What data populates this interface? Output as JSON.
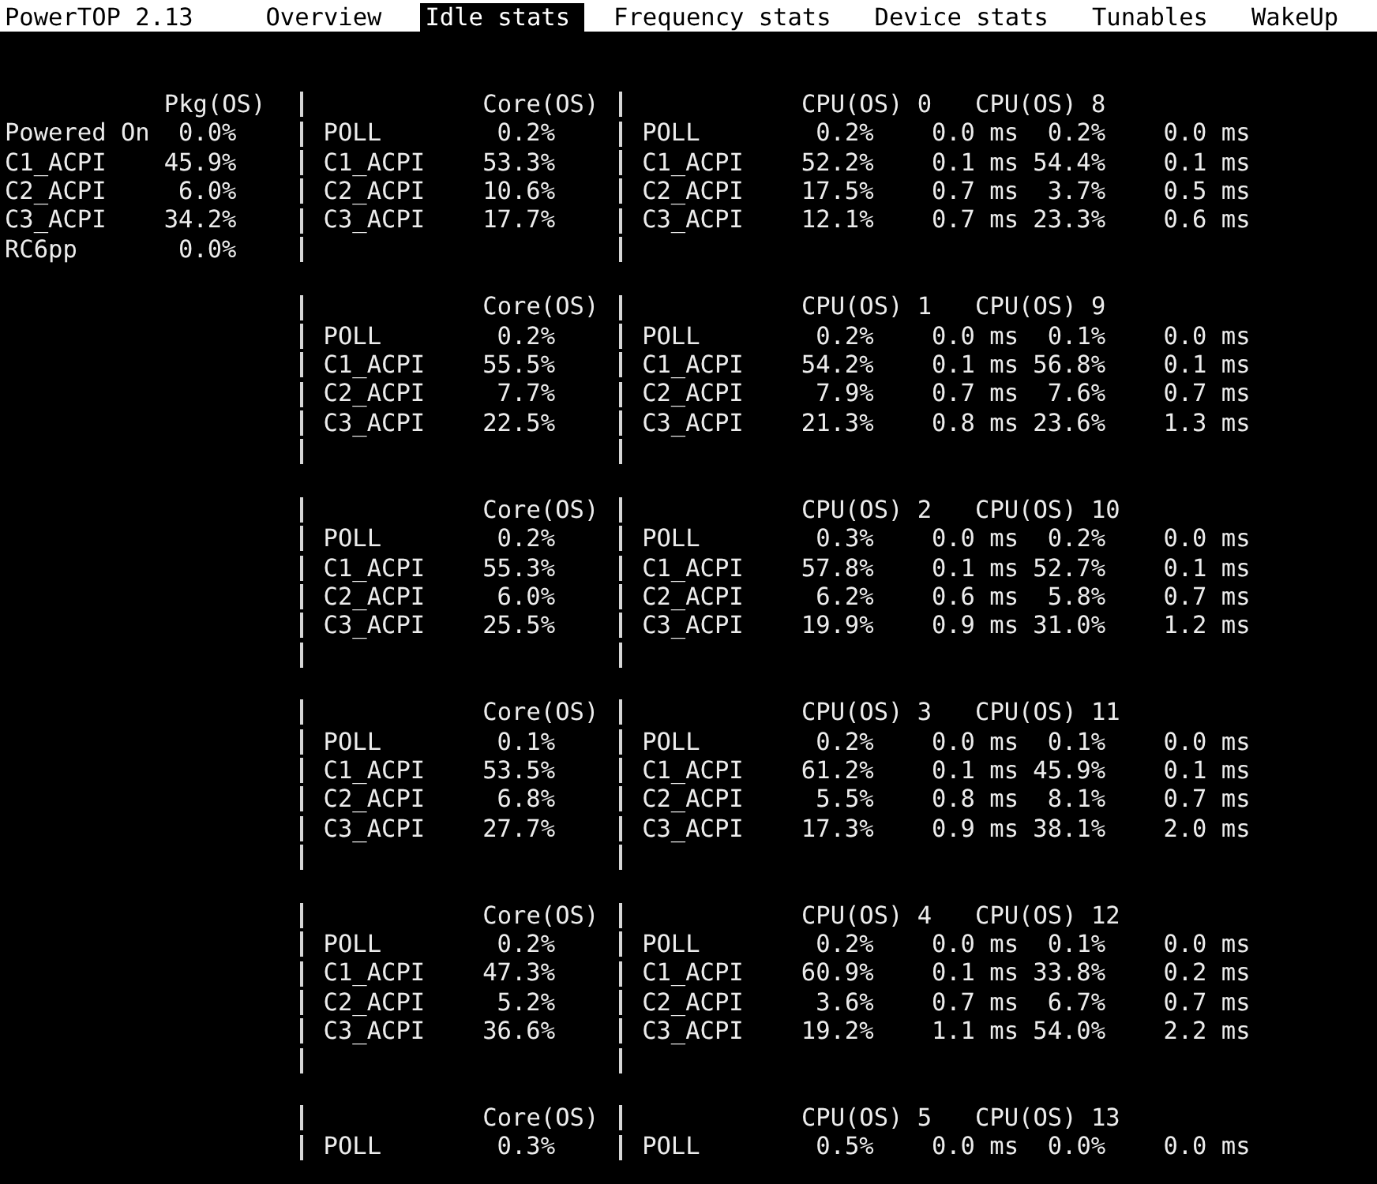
{
  "header": {
    "title": "PowerTOP 2.13",
    "tabs": [
      {
        "label": "Overview",
        "selected": false
      },
      {
        "label": "Idle stats",
        "selected": true
      },
      {
        "label": "Frequency stats",
        "selected": false
      },
      {
        "label": "Device stats",
        "selected": false
      },
      {
        "label": "Tunables",
        "selected": false
      },
      {
        "label": "WakeUp",
        "selected": false
      }
    ]
  },
  "package": {
    "heading": "Pkg(OS)",
    "states": [
      {
        "name": "Powered On",
        "value": "0.0%"
      },
      {
        "name": "C1_ACPI",
        "value": "45.9%"
      },
      {
        "name": "C2_ACPI",
        "value": "6.0%"
      },
      {
        "name": "C3_ACPI",
        "value": "34.2%"
      },
      {
        "name": "RC6pp",
        "value": "0.0%"
      }
    ]
  },
  "blocks": [
    {
      "core_heading": "Core(OS)",
      "cpu_headings": [
        "CPU(OS) 0",
        "CPU(OS) 8"
      ],
      "rows": [
        {
          "core_state": "POLL",
          "core_value": "0.2%",
          "cpu_state": "POLL",
          "cpu_cells": [
            "0.2%",
            "0.0 ms",
            "0.2%",
            "0.0 ms"
          ]
        },
        {
          "core_state": "C1_ACPI",
          "core_value": "53.3%",
          "cpu_state": "C1_ACPI",
          "cpu_cells": [
            "52.2%",
            "0.1 ms",
            "54.4%",
            "0.1 ms"
          ]
        },
        {
          "core_state": "C2_ACPI",
          "core_value": "10.6%",
          "cpu_state": "C2_ACPI",
          "cpu_cells": [
            "17.5%",
            "0.7 ms",
            "3.7%",
            "0.5 ms"
          ]
        },
        {
          "core_state": "C3_ACPI",
          "core_value": "17.7%",
          "cpu_state": "C3_ACPI",
          "cpu_cells": [
            "12.1%",
            "0.7 ms",
            "23.3%",
            "0.6 ms"
          ]
        }
      ]
    },
    {
      "core_heading": "Core(OS)",
      "cpu_headings": [
        "CPU(OS) 1",
        "CPU(OS) 9"
      ],
      "rows": [
        {
          "core_state": "POLL",
          "core_value": "0.2%",
          "cpu_state": "POLL",
          "cpu_cells": [
            "0.2%",
            "0.0 ms",
            "0.1%",
            "0.0 ms"
          ]
        },
        {
          "core_state": "C1_ACPI",
          "core_value": "55.5%",
          "cpu_state": "C1_ACPI",
          "cpu_cells": [
            "54.2%",
            "0.1 ms",
            "56.8%",
            "0.1 ms"
          ]
        },
        {
          "core_state": "C2_ACPI",
          "core_value": "7.7%",
          "cpu_state": "C2_ACPI",
          "cpu_cells": [
            "7.9%",
            "0.7 ms",
            "7.6%",
            "0.7 ms"
          ]
        },
        {
          "core_state": "C3_ACPI",
          "core_value": "22.5%",
          "cpu_state": "C3_ACPI",
          "cpu_cells": [
            "21.3%",
            "0.8 ms",
            "23.6%",
            "1.3 ms"
          ]
        }
      ]
    },
    {
      "core_heading": "Core(OS)",
      "cpu_headings": [
        "CPU(OS) 2",
        "CPU(OS) 10"
      ],
      "rows": [
        {
          "core_state": "POLL",
          "core_value": "0.2%",
          "cpu_state": "POLL",
          "cpu_cells": [
            "0.3%",
            "0.0 ms",
            "0.2%",
            "0.0 ms"
          ]
        },
        {
          "core_state": "C1_ACPI",
          "core_value": "55.3%",
          "cpu_state": "C1_ACPI",
          "cpu_cells": [
            "57.8%",
            "0.1 ms",
            "52.7%",
            "0.1 ms"
          ]
        },
        {
          "core_state": "C2_ACPI",
          "core_value": "6.0%",
          "cpu_state": "C2_ACPI",
          "cpu_cells": [
            "6.2%",
            "0.6 ms",
            "5.8%",
            "0.7 ms"
          ]
        },
        {
          "core_state": "C3_ACPI",
          "core_value": "25.5%",
          "cpu_state": "C3_ACPI",
          "cpu_cells": [
            "19.9%",
            "0.9 ms",
            "31.0%",
            "1.2 ms"
          ]
        }
      ]
    },
    {
      "core_heading": "Core(OS)",
      "cpu_headings": [
        "CPU(OS) 3",
        "CPU(OS) 11"
      ],
      "rows": [
        {
          "core_state": "POLL",
          "core_value": "0.1%",
          "cpu_state": "POLL",
          "cpu_cells": [
            "0.2%",
            "0.0 ms",
            "0.1%",
            "0.0 ms"
          ]
        },
        {
          "core_state": "C1_ACPI",
          "core_value": "53.5%",
          "cpu_state": "C1_ACPI",
          "cpu_cells": [
            "61.2%",
            "0.1 ms",
            "45.9%",
            "0.1 ms"
          ]
        },
        {
          "core_state": "C2_ACPI",
          "core_value": "6.8%",
          "cpu_state": "C2_ACPI",
          "cpu_cells": [
            "5.5%",
            "0.8 ms",
            "8.1%",
            "0.7 ms"
          ]
        },
        {
          "core_state": "C3_ACPI",
          "core_value": "27.7%",
          "cpu_state": "C3_ACPI",
          "cpu_cells": [
            "17.3%",
            "0.9 ms",
            "38.1%",
            "2.0 ms"
          ]
        }
      ]
    },
    {
      "core_heading": "Core(OS)",
      "cpu_headings": [
        "CPU(OS) 4",
        "CPU(OS) 12"
      ],
      "rows": [
        {
          "core_state": "POLL",
          "core_value": "0.2%",
          "cpu_state": "POLL",
          "cpu_cells": [
            "0.2%",
            "0.0 ms",
            "0.1%",
            "0.0 ms"
          ]
        },
        {
          "core_state": "C1_ACPI",
          "core_value": "47.3%",
          "cpu_state": "C1_ACPI",
          "cpu_cells": [
            "60.9%",
            "0.1 ms",
            "33.8%",
            "0.2 ms"
          ]
        },
        {
          "core_state": "C2_ACPI",
          "core_value": "5.2%",
          "cpu_state": "C2_ACPI",
          "cpu_cells": [
            "3.6%",
            "0.7 ms",
            "6.7%",
            "0.7 ms"
          ]
        },
        {
          "core_state": "C3_ACPI",
          "core_value": "36.6%",
          "cpu_state": "C3_ACPI",
          "cpu_cells": [
            "19.2%",
            "1.1 ms",
            "54.0%",
            "2.2 ms"
          ]
        }
      ]
    },
    {
      "core_heading": "Core(OS)",
      "cpu_headings": [
        "CPU(OS) 5",
        "CPU(OS) 13"
      ],
      "rows": [
        {
          "core_state": "POLL",
          "core_value": "0.3%",
          "cpu_state": "POLL",
          "cpu_cells": [
            "0.5%",
            "0.0 ms",
            "0.0%",
            "0.0 ms"
          ]
        }
      ]
    }
  ]
}
